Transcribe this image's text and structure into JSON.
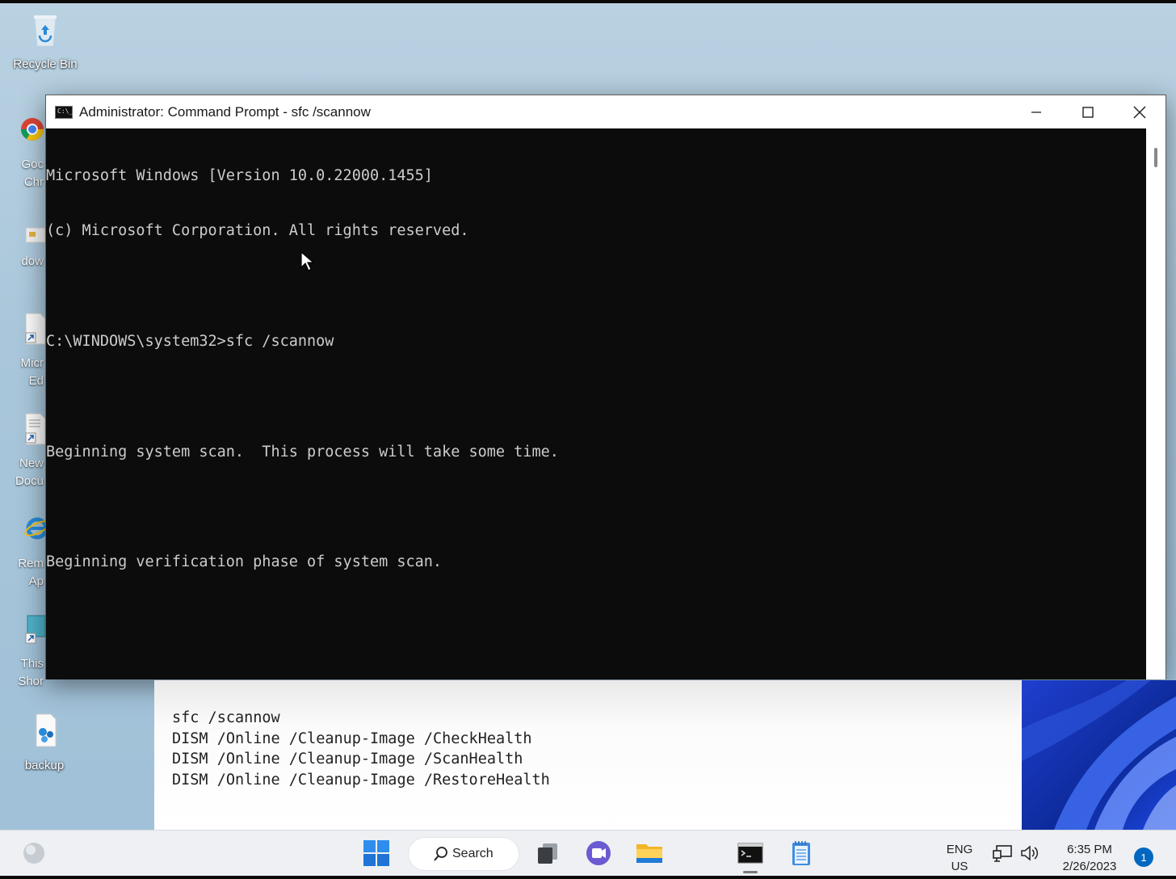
{
  "desktop": {
    "recycle_bin": "Recycle Bin",
    "backup": "backup",
    "partial_icons": [
      {
        "line1": "Goc",
        "line2": "Chr"
      },
      {
        "line1": "dow",
        "line2": ""
      },
      {
        "line1": "Micr",
        "line2": "Ed"
      },
      {
        "line1": "New",
        "line2": "Docu"
      },
      {
        "line1": "Rem",
        "line2": "Ap"
      },
      {
        "line1": "This",
        "line2": "Shor"
      }
    ]
  },
  "window": {
    "title": "Administrator: Command Prompt - sfc  /scannow",
    "icon_glyph": "C:\\_",
    "controls": {
      "minimize": "minimize-icon",
      "maximize": "maximize-icon",
      "close": "close-icon"
    }
  },
  "console": {
    "lines": [
      "Microsoft Windows [Version 10.0.22000.1455]",
      "(c) Microsoft Corporation. All rights reserved.",
      "",
      "C:\\WINDOWS\\system32>sfc /scannow",
      "",
      "Beginning system scan.  This process will take some time.",
      "",
      "Beginning verification phase of system scan."
    ]
  },
  "notes": {
    "lines": [
      "sfc /scannow",
      "DISM /Online /Cleanup-Image /CheckHealth",
      "DISM /Online /Cleanup-Image /ScanHealth",
      "DISM /Online /Cleanup-Image /RestoreHealth"
    ]
  },
  "taskbar": {
    "search_label": "Search",
    "language": {
      "line1": "ENG",
      "line2": "US"
    },
    "clock": {
      "time": "6:35 PM",
      "date": "2/26/2023"
    },
    "notification_count": "1"
  },
  "colors": {
    "console_bg": "#0c0c0c",
    "console_fg": "#cccccc",
    "accent": "#0067c0"
  }
}
